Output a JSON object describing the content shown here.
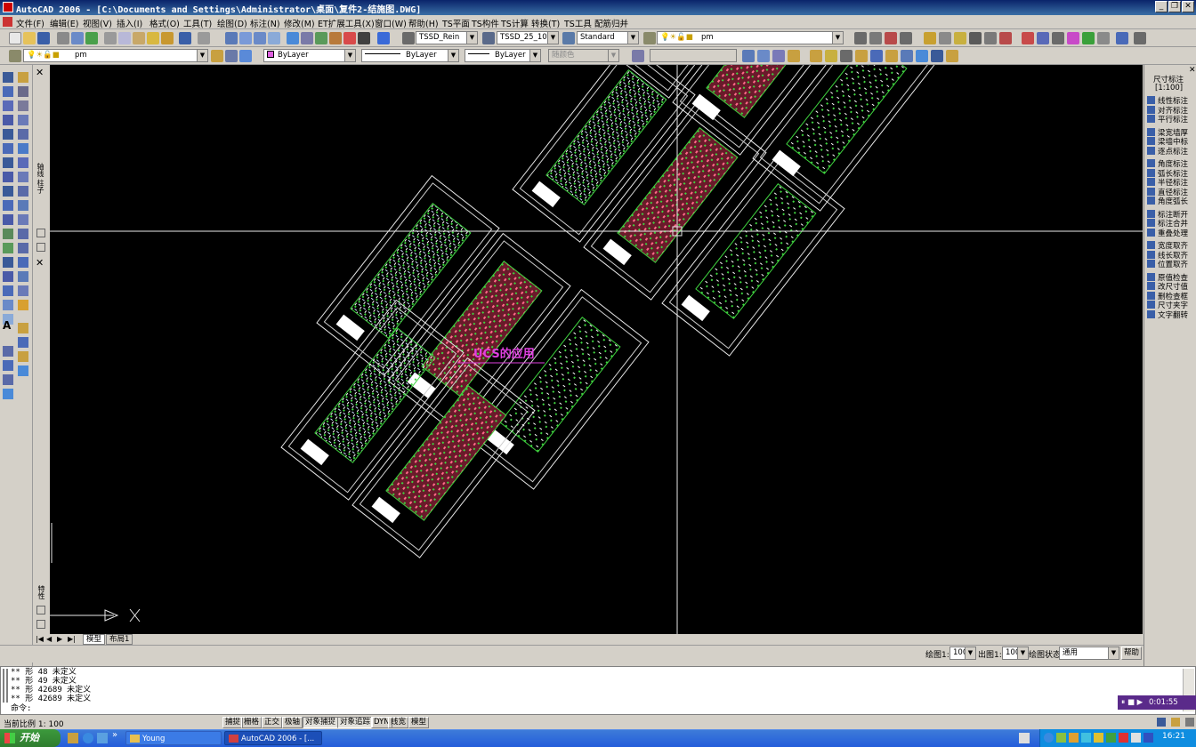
{
  "window": {
    "title": "AutoCAD 2006 - [C:\\Documents and Settings\\Administrator\\桌面\\复件2-结施图.DWG]",
    "minimize_label": "_",
    "restore_label": "❐",
    "close_label": "✕"
  },
  "menu": [
    {
      "label": "文件(F)"
    },
    {
      "label": "编辑(E)"
    },
    {
      "label": "视图(V)"
    },
    {
      "label": "插入(I)"
    },
    {
      "label": "格式(O)"
    },
    {
      "label": "工具(T)"
    },
    {
      "label": "绘图(D)"
    },
    {
      "label": "标注(N)"
    },
    {
      "label": "修改(M)"
    },
    {
      "label": "ET扩展工具(X)"
    },
    {
      "label": "窗口(W)"
    },
    {
      "label": "帮助(H)"
    },
    {
      "label": "TS平面"
    },
    {
      "label": "TS构件"
    },
    {
      "label": "TS计算"
    },
    {
      "label": "转换(T)"
    },
    {
      "label": "TS工具"
    },
    {
      "label": "配筋归并"
    }
  ],
  "toolbar1": {
    "text_style": "TSSD_Rein",
    "dim_style": "TSSD_25_100",
    "table_style": "Standard",
    "layer": "pm"
  },
  "toolbar2": {
    "layer": "pm",
    "color": "ByLayer",
    "linetype": "ByLayer",
    "lineweight": "ByLayer",
    "plotstyle": "随颜色"
  },
  "drawing": {
    "annotation": "UCS的应用",
    "annotation_color": "#e040e0",
    "background": "#000000"
  },
  "side_panel_left": {
    "label_top": "轴线 柱子",
    "label_bottom": "特性"
  },
  "right_panel": {
    "title": "尺寸标注",
    "scale": "[1:100]",
    "items": [
      {
        "label": "线性标注"
      },
      {
        "label": "对齐标注"
      },
      {
        "label": "平行标注"
      },
      {
        "label": "梁宽墙厚"
      },
      {
        "label": "梁墙中标"
      },
      {
        "label": "逐点标注"
      },
      {
        "label": "角度标注"
      },
      {
        "label": "弧长标注"
      },
      {
        "label": "半径标注"
      },
      {
        "label": "直径标注"
      },
      {
        "label": "角度弧长"
      },
      {
        "label": "标注断开"
      },
      {
        "label": "标注合并"
      },
      {
        "label": "重叠处理"
      },
      {
        "label": "宽度取齐"
      },
      {
        "label": "线长取齐"
      },
      {
        "label": "位置取齐"
      },
      {
        "label": "原值检查"
      },
      {
        "label": "改尺寸值"
      },
      {
        "label": "删检查框"
      },
      {
        "label": "尺寸夹字"
      },
      {
        "label": "文字翻转"
      }
    ]
  },
  "tabs": [
    {
      "label": "模型"
    },
    {
      "label": "布局1"
    }
  ],
  "scale_bar": {
    "draw_label": "绘图1:",
    "draw_value": "100",
    "out_label": "出图1:",
    "out_value": "100",
    "state_label": "绘图状态",
    "state_value": "通用",
    "help_label": "帮助"
  },
  "command": {
    "lines": [
      "** 形 48 未定义",
      "** 形 49 未定义",
      "** 形 42689 未定义",
      "** 形 42689 未定义"
    ],
    "prompt": "命令:"
  },
  "status": {
    "scale_text": "当前比例 1: 100",
    "buttons": [
      {
        "label": "捕捉",
        "on": false
      },
      {
        "label": "栅格",
        "on": false
      },
      {
        "label": "正交",
        "on": false
      },
      {
        "label": "极轴",
        "on": false
      },
      {
        "label": "对象捕捉",
        "on": true
      },
      {
        "label": "对象追踪",
        "on": true
      },
      {
        "label": "DYN",
        "on": false
      },
      {
        "label": "线宽",
        "on": false
      },
      {
        "label": "模型",
        "on": false
      }
    ]
  },
  "taskbar": {
    "start_label": "开始",
    "tasks": [
      {
        "label": "Young"
      },
      {
        "label": "AutoCAD 2006 - [..."
      }
    ],
    "clock": "16:21"
  },
  "media_player": {
    "time": "0:01:55"
  }
}
